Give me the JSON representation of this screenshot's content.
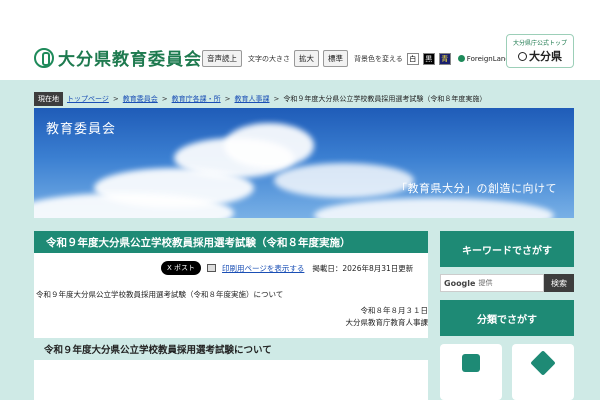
{
  "header": {
    "site_title": "大分県教育委員会",
    "tools": {
      "read_aloud": "音声読上",
      "text_size_label": "文字の大きさ",
      "enlarge": "拡大",
      "standard": "標準",
      "bg_color_label": "背景色を変える",
      "color_white": "白",
      "color_black": "黒",
      "color_blue": "青",
      "foreign_language": "ForeignLanguage"
    },
    "pref_link": {
      "sub": "大分県庁公式トップ",
      "main": "大分県"
    }
  },
  "breadcrumb": {
    "here_label": "現在地",
    "items": [
      "トップページ",
      "教育委員会",
      "教育庁各課・所",
      "教育人事課"
    ],
    "current": "令和９年度大分県公立学校教員採用選考試験（令和８年度実施）"
  },
  "hero": {
    "title": "教育委員会",
    "slogan": "「教育県大分」の創造に向けて"
  },
  "article": {
    "title": "令和９年度大分県公立学校教員採用選考試験（令和８年度実施）",
    "x_post": "X ポスト",
    "print_label": "印刷用ページを表示する",
    "updated": "掲載日：2026年8月31日更新",
    "lead": "令和９年度大分県公立学校教員採用選考試験（令和８年度実施）について",
    "date": "令和８年８月３１日",
    "department": "大分県教育庁教育人事課",
    "section_title": "令和９年度大分県公立学校教員採用選考試験について"
  },
  "sidebar": {
    "keyword_heading": "キーワードでさがす",
    "search_placeholder": "提供",
    "search_brand": "Google",
    "search_button": "検索",
    "category_heading": "分類でさがす"
  },
  "colors": {
    "brand_green": "#1e8a75",
    "band_teal": "#cfeae6",
    "link_blue": "#1a4fb5"
  }
}
